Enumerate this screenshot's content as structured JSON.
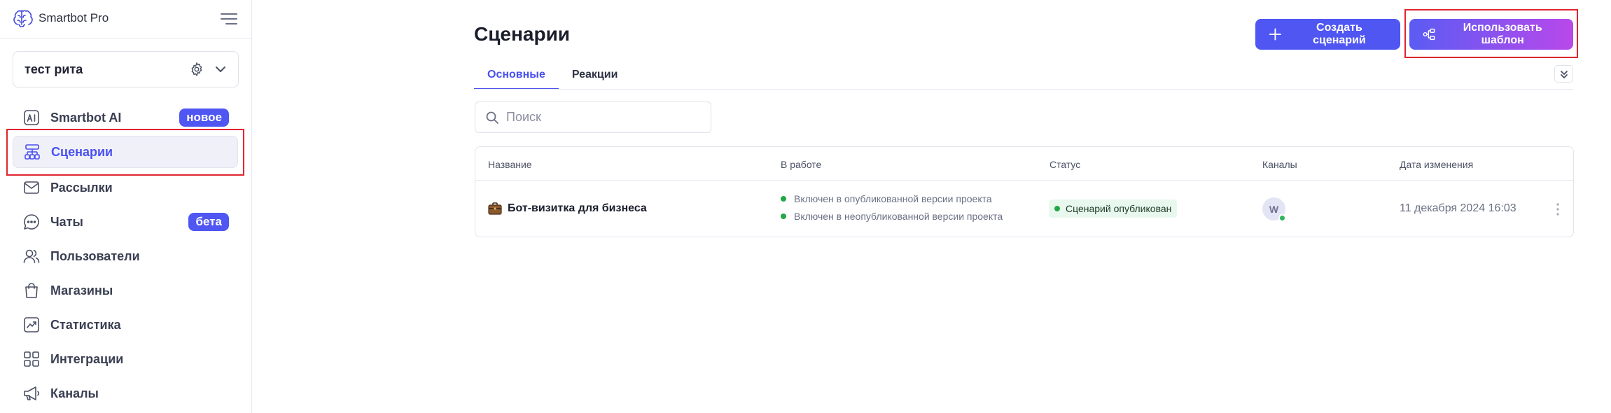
{
  "app": {
    "name": "Smartbot Pro"
  },
  "project": {
    "name": "тест рита"
  },
  "sidebar": {
    "items": [
      {
        "label": "Smartbot AI",
        "badge": "новое"
      },
      {
        "label": "Сценарии"
      },
      {
        "label": "Рассылки"
      },
      {
        "label": "Чаты",
        "badge": "бета"
      },
      {
        "label": "Пользователи"
      },
      {
        "label": "Магазины"
      },
      {
        "label": "Статистика"
      },
      {
        "label": "Интеграции"
      },
      {
        "label": "Каналы"
      }
    ]
  },
  "main": {
    "title": "Сценарии",
    "create_label": "Создать сценарий",
    "template_label": "Использовать шаблон",
    "tabs": [
      {
        "label": "Основные"
      },
      {
        "label": "Реакции"
      }
    ],
    "search": {
      "placeholder": "Поиск",
      "value": ""
    },
    "table": {
      "headers": [
        "Название",
        "В работе",
        "Статус",
        "Каналы",
        "Дата изменения"
      ],
      "rows": [
        {
          "name": "Бот-визитка для бизнеса",
          "work": [
            "Включен в опубликованной версии проекта",
            "Включен в неопубликованной версии проекта"
          ],
          "status": "Сценарий опубликован",
          "channel_initial": "W",
          "date": "11 декабря 2024 16:03"
        }
      ]
    }
  },
  "colors": {
    "accent": "#4f56f2",
    "highlight": "#e0252e",
    "status_green": "#22a745"
  }
}
